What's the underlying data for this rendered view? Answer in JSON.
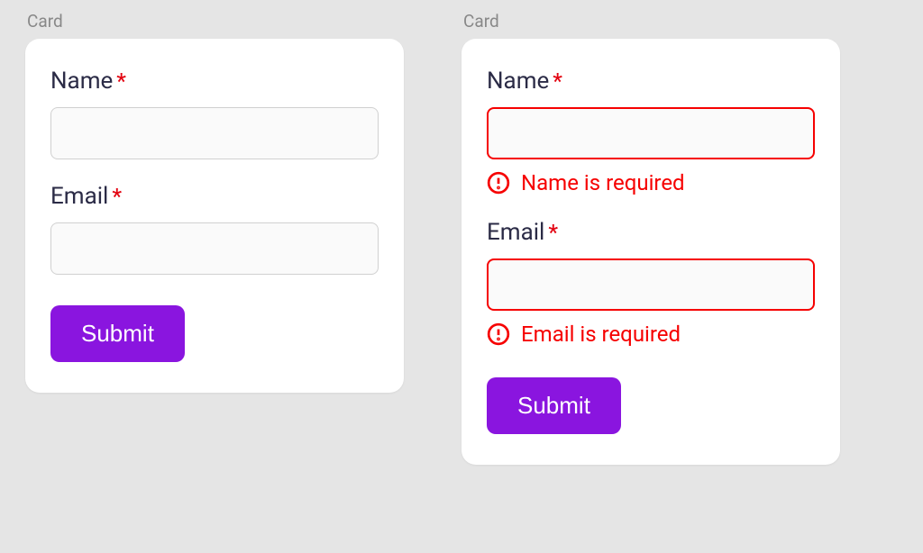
{
  "cards": {
    "left": {
      "title": "Card",
      "fields": {
        "name": {
          "label": "Name",
          "required": "*",
          "value": ""
        },
        "email": {
          "label": "Email",
          "required": "*",
          "value": ""
        }
      },
      "submit": "Submit"
    },
    "right": {
      "title": "Card",
      "fields": {
        "name": {
          "label": "Name",
          "required": "*",
          "value": "",
          "error": "Name is required"
        },
        "email": {
          "label": "Email",
          "required": "*",
          "value": "",
          "error": "Email is required"
        }
      },
      "submit": "Submit"
    }
  },
  "colors": {
    "accent": "#8a15df",
    "error": "#f60000",
    "text": "#2b2b46"
  }
}
